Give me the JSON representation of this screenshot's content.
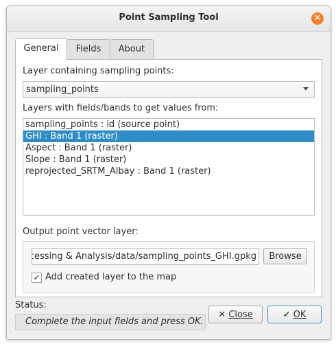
{
  "window": {
    "title": "Point Sampling Tool"
  },
  "tabs": [
    {
      "label": "General"
    },
    {
      "label": "Fields"
    },
    {
      "label": "About"
    }
  ],
  "general": {
    "layer_label": "Layer containing sampling points:",
    "layer_value": "sampling_points",
    "fields_label": "Layers with fields/bands to get values from:",
    "layers": [
      {
        "label": "sampling_points : id (source point)",
        "selected": false
      },
      {
        "label": "GHI : Band 1 (raster)",
        "selected": true
      },
      {
        "label": "Aspect : Band 1 (raster)",
        "selected": false
      },
      {
        "label": "Slope : Band 1 (raster)",
        "selected": false
      },
      {
        "label": "reprojected_SRTM_Albay : Band 1 (raster)",
        "selected": false
      }
    ],
    "output_label": "Output point vector layer:",
    "output_value": "cessing & Analysis/data/sampling_points_GHI.gpkg",
    "browse_label": "Browse",
    "add_layer_label": "Add created layer to the map",
    "add_layer_checked": true
  },
  "status": {
    "label": "Status:",
    "message": "Complete the input fields and press OK."
  },
  "buttons": {
    "close_label": "Close",
    "ok_label": "OK"
  }
}
